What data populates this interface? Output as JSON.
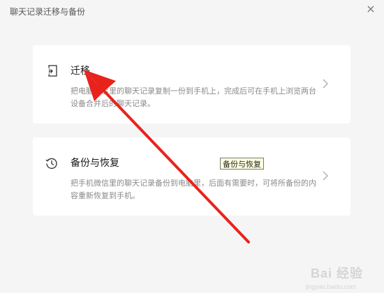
{
  "window": {
    "title": "聊天记录迁移与备份",
    "close_label": "×"
  },
  "cards": {
    "migrate": {
      "title": "迁移",
      "description": "把电脑微信里的聊天记录复制一份到手机上，完成后可在手机上浏览两台设备合并后的聊天记录。",
      "icon": "migrate-icon"
    },
    "backup": {
      "title": "备份与恢复",
      "description": "把手机微信里的聊天记录备份到电脑里，后面有需要时，可将所备份的内容重新恢复到手机。",
      "icon": "history-icon"
    }
  },
  "tooltip": {
    "text": "备份与恢复"
  },
  "watermark": {
    "text": "Bai 经验",
    "sub": "jingyan.baidu.com"
  },
  "colors": {
    "annotation_arrow": "#e8231c",
    "card_bg": "#ffffff",
    "window_bg": "#f5f5f5"
  }
}
